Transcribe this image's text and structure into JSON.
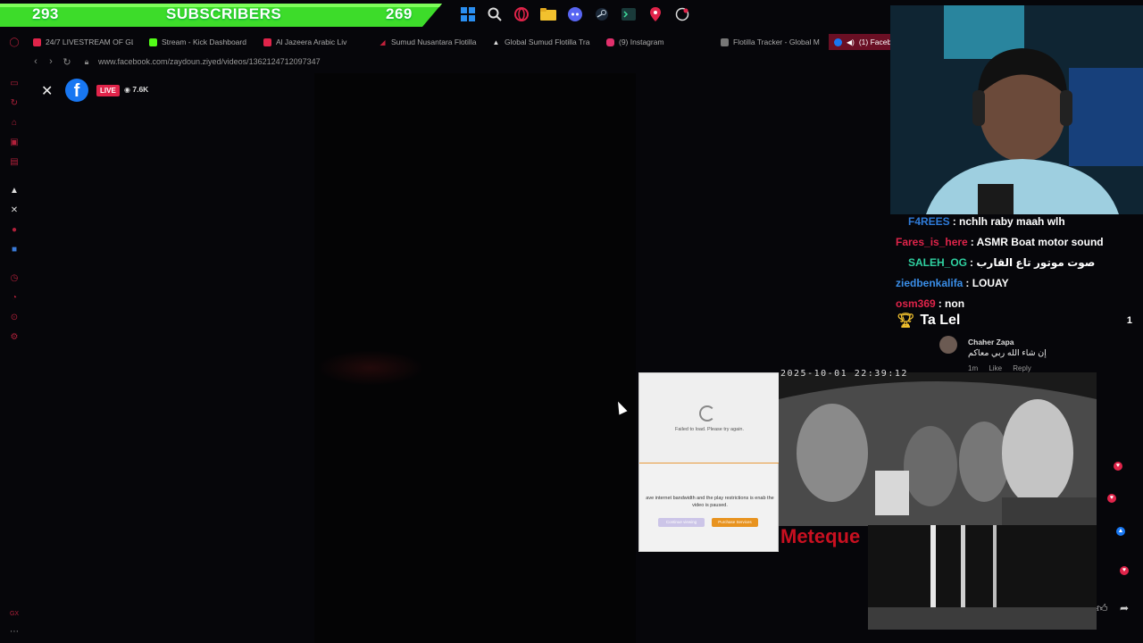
{
  "subscriber_bar": {
    "left_count": "293",
    "title": "SUBSCRIBERS",
    "right_count": "269",
    "color": "#3ddc2a"
  },
  "taskbar": {
    "icons": [
      "windows-icon",
      "search-icon",
      "opera-icon",
      "folder-icon",
      "discord-icon",
      "steam-icon",
      "terminal-icon",
      "map-pin-icon",
      "chat-bubble-icon"
    ]
  },
  "browser": {
    "tabs": [
      {
        "label": "24/7 LIVESTREAM OF GL",
        "icon": "youtube-icon",
        "color": "#e0244a"
      },
      {
        "label": "Stream - Kick Dashboard",
        "icon": "kick-icon",
        "color": "#53fc18"
      },
      {
        "label": "Al Jazeera Arabic Liv",
        "icon": "youtube-icon",
        "color": "#e0244a"
      },
      {
        "label": "Sumud Nusantara Flotilla",
        "icon": "site-icon",
        "color": "#c0203a"
      },
      {
        "label": "Global Sumud Flotilla Tra",
        "icon": "triangle-icon",
        "color": "#dddddd"
      },
      {
        "label": "(9) Instagram",
        "icon": "instagram-icon",
        "color": "#e1306c"
      },
      {
        "label": "Flotilla Tracker - Global M",
        "icon": "site-icon",
        "color": "#888888"
      },
      {
        "label": "(1) Facebo",
        "icon": "facebook-icon",
        "color": "#1877f2"
      }
    ],
    "url": "www.facebook.com/zaydoun.ziyed/videos/1362124712097347"
  },
  "facebook_header": {
    "live_label": "LIVE",
    "viewers": "7.6K"
  },
  "chat": {
    "messages": [
      {
        "user": "F4REES",
        "message": ": nchlh raby maah wlh",
        "color": "#2f7bd8"
      },
      {
        "user": "Fares_is_here",
        "message": ": ASMR Boat motor sound",
        "color": "#e0244a"
      },
      {
        "user": "SALEH_OG",
        "message": ": صوت موتور تاع القارب",
        "color": "#2fd0a0"
      },
      {
        "user": "ziedbenkalifa",
        "message": ": LOUAY",
        "color": "#3a8ee8"
      },
      {
        "user": "osm369",
        "message": ": non",
        "color": "#e0244a"
      }
    ],
    "pinned": {
      "name": "Ta Lel",
      "count": "1"
    }
  },
  "fb_comment": {
    "name": "Chaher Zapa",
    "text": "إن شاء الله ربي معاكم",
    "time": "1m",
    "like": "Like",
    "reply": "Reply"
  },
  "error_overlay": {
    "message": "Failed to load. Please try again.",
    "detail": "ave internet bandwidth and the play restrictions is enab the video is paused.",
    "continue_button": "Continue viewing",
    "purchase_button": "Purchase Services"
  },
  "video": {
    "timestamp": "2025-10-01 22:39:12",
    "watermark": "Meteque"
  }
}
